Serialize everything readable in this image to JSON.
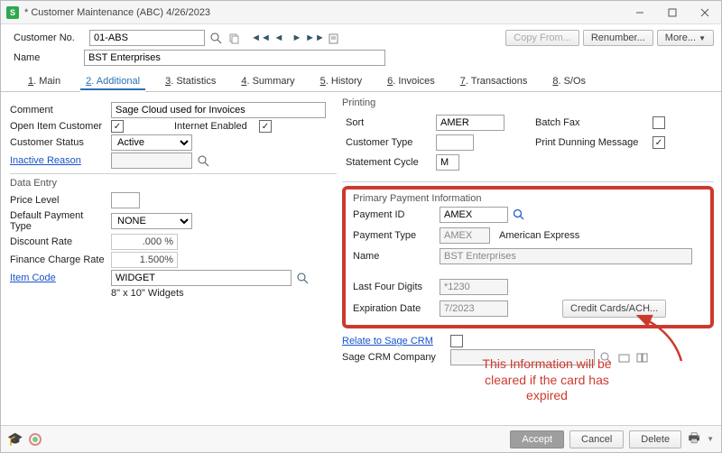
{
  "title": "* Customer Maintenance (ABC) 4/26/2023",
  "toprow": {
    "customer_no_label": "Customer No.",
    "customer_no_value": "01-ABS",
    "copy_from": "Copy From...",
    "renumber": "Renumber...",
    "more": "More..."
  },
  "name_row": {
    "label": "Name",
    "value": "BST Enterprises"
  },
  "tabs": {
    "main": "Main",
    "additional": "Additional",
    "statistics": "Statistics",
    "summary": "Summary",
    "history": "History",
    "invoices": "Invoices",
    "transactions": "Transactions",
    "sos": "S/Os"
  },
  "left": {
    "comment_label": "Comment",
    "comment_value": "Sage Cloud used for Invoices",
    "open_item_label": "Open Item Customer",
    "internet_label": "Internet Enabled",
    "status_label": "Customer Status",
    "status_value": "Active",
    "inactive_reason": "Inactive Reason",
    "data_entry": "Data Entry",
    "price_level_label": "Price Level",
    "default_payment_label": "Default Payment Type",
    "default_payment_value": "NONE",
    "discount_label": "Discount Rate",
    "discount_value": ".000 %",
    "finance_label": "Finance Charge Rate",
    "finance_value": "1.500%",
    "item_code_label": "Item Code",
    "item_code_value": "WIDGET",
    "item_code_desc": "8\" x 10\" Widgets"
  },
  "printing": {
    "title": "Printing",
    "sort_label": "Sort",
    "sort_value": "AMER",
    "batch_fax_label": "Batch Fax",
    "cust_type_label": "Customer Type",
    "cust_type_value": "",
    "dunning_label": "Print Dunning Message",
    "stmt_cycle_label": "Statement Cycle",
    "stmt_cycle_value": "M"
  },
  "primary": {
    "title": "Primary Payment Information",
    "payment_id_label": "Payment ID",
    "payment_id_value": "AMEX",
    "payment_type_label": "Payment Type",
    "payment_type_value": "AMEX",
    "payment_type_desc": "American Express",
    "name_label": "Name",
    "name_value": "BST Enterprises",
    "last4_label": "Last Four Digits",
    "last4_value": "*1230",
    "exp_label": "Expiration Date",
    "exp_value": "7/2023",
    "cc_btn": "Credit Cards/ACH..."
  },
  "crm": {
    "relate_label": "Relate to Sage CRM",
    "company_label": "Sage CRM Company"
  },
  "annotation_line1": "This Information will be",
  "annotation_line2": "cleared if the card has",
  "annotation_line3": "expired",
  "bottom": {
    "accept": "Accept",
    "cancel": "Cancel",
    "delete": "Delete"
  }
}
